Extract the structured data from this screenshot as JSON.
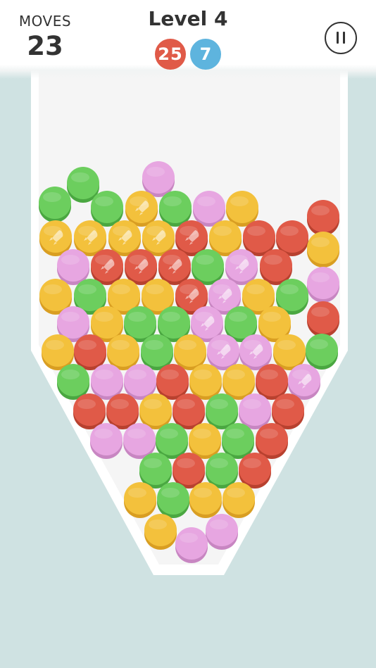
{
  "hud": {
    "moves_label": "MOVES",
    "moves_value": "23",
    "level_title": "Level 4",
    "goals": [
      {
        "color": "red",
        "count": "25"
      },
      {
        "color": "blue",
        "count": "7"
      }
    ]
  },
  "colors": {
    "green": "#6cce5e",
    "yellow": "#f3c13c",
    "red": "#e05a48",
    "pink": "#e7a6e1",
    "goal_blue": "#5eb4de",
    "background": "#cfe2e2"
  },
  "balls": [
    {
      "color": "pink",
      "rocket": false
    },
    {
      "color": "green",
      "rocket": false
    },
    {
      "color": "green",
      "rocket": false
    },
    {
      "color": "green",
      "rocket": false
    },
    {
      "color": "yellow",
      "rocket": true
    },
    {
      "color": "green",
      "rocket": false
    },
    {
      "color": "pink",
      "rocket": false
    },
    {
      "color": "yellow",
      "rocket": false
    },
    {
      "color": "red",
      "rocket": false
    },
    {
      "color": "yellow",
      "rocket": true
    },
    {
      "color": "yellow",
      "rocket": true
    },
    {
      "color": "yellow",
      "rocket": true
    },
    {
      "color": "yellow",
      "rocket": true
    },
    {
      "color": "red",
      "rocket": true
    },
    {
      "color": "yellow",
      "rocket": false
    },
    {
      "color": "red",
      "rocket": false
    },
    {
      "color": "red",
      "rocket": false
    },
    {
      "color": "yellow",
      "rocket": false
    },
    {
      "color": "pink",
      "rocket": false
    },
    {
      "color": "red",
      "rocket": true
    },
    {
      "color": "red",
      "rocket": true
    },
    {
      "color": "red",
      "rocket": true
    },
    {
      "color": "green",
      "rocket": false
    },
    {
      "color": "pink",
      "rocket": true
    },
    {
      "color": "red",
      "rocket": false
    },
    {
      "color": "pink",
      "rocket": false
    },
    {
      "color": "yellow",
      "rocket": false
    },
    {
      "color": "green",
      "rocket": false
    },
    {
      "color": "yellow",
      "rocket": false
    },
    {
      "color": "yellow",
      "rocket": false
    },
    {
      "color": "red",
      "rocket": true
    },
    {
      "color": "pink",
      "rocket": true
    },
    {
      "color": "yellow",
      "rocket": false
    },
    {
      "color": "green",
      "rocket": false
    },
    {
      "color": "red",
      "rocket": false
    },
    {
      "color": "pink",
      "rocket": false
    },
    {
      "color": "yellow",
      "rocket": false
    },
    {
      "color": "green",
      "rocket": false
    },
    {
      "color": "green",
      "rocket": false
    },
    {
      "color": "pink",
      "rocket": true
    },
    {
      "color": "green",
      "rocket": false
    },
    {
      "color": "yellow",
      "rocket": false
    },
    {
      "color": "green",
      "rocket": false
    },
    {
      "color": "yellow",
      "rocket": false
    },
    {
      "color": "red",
      "rocket": false
    },
    {
      "color": "yellow",
      "rocket": false
    },
    {
      "color": "green",
      "rocket": false
    },
    {
      "color": "yellow",
      "rocket": false
    },
    {
      "color": "pink",
      "rocket": true
    },
    {
      "color": "pink",
      "rocket": true
    },
    {
      "color": "yellow",
      "rocket": false
    },
    {
      "color": "green",
      "rocket": false
    },
    {
      "color": "pink",
      "rocket": false
    },
    {
      "color": "pink",
      "rocket": false
    },
    {
      "color": "red",
      "rocket": false
    },
    {
      "color": "yellow",
      "rocket": false
    },
    {
      "color": "yellow",
      "rocket": false
    },
    {
      "color": "red",
      "rocket": false
    },
    {
      "color": "pink",
      "rocket": true
    },
    {
      "color": "red",
      "rocket": false
    },
    {
      "color": "red",
      "rocket": false
    },
    {
      "color": "yellow",
      "rocket": false
    },
    {
      "color": "red",
      "rocket": false
    },
    {
      "color": "green",
      "rocket": false
    },
    {
      "color": "pink",
      "rocket": false
    },
    {
      "color": "red",
      "rocket": false
    },
    {
      "color": "pink",
      "rocket": false
    },
    {
      "color": "pink",
      "rocket": false
    },
    {
      "color": "green",
      "rocket": false
    },
    {
      "color": "yellow",
      "rocket": false
    },
    {
      "color": "green",
      "rocket": false
    },
    {
      "color": "red",
      "rocket": false
    },
    {
      "color": "green",
      "rocket": false
    },
    {
      "color": "red",
      "rocket": false
    },
    {
      "color": "green",
      "rocket": false
    },
    {
      "color": "red",
      "rocket": false
    },
    {
      "color": "yellow",
      "rocket": false
    },
    {
      "color": "green",
      "rocket": false
    },
    {
      "color": "yellow",
      "rocket": false
    },
    {
      "color": "yellow",
      "rocket": false
    },
    {
      "color": "yellow",
      "rocket": false
    },
    {
      "color": "pink",
      "rocket": false
    },
    {
      "color": "pink",
      "rocket": false
    }
  ]
}
